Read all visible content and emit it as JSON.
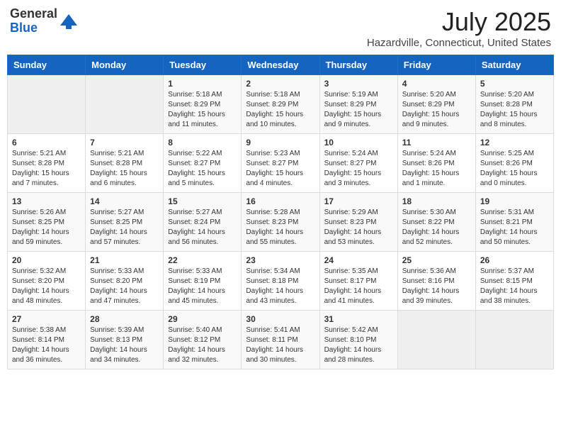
{
  "logo": {
    "general": "General",
    "blue": "Blue"
  },
  "title": {
    "month_year": "July 2025",
    "location": "Hazardville, Connecticut, United States"
  },
  "weekdays": [
    "Sunday",
    "Monday",
    "Tuesday",
    "Wednesday",
    "Thursday",
    "Friday",
    "Saturday"
  ],
  "weeks": [
    [
      {
        "day": "",
        "sunrise": "",
        "sunset": "",
        "daylight": ""
      },
      {
        "day": "",
        "sunrise": "",
        "sunset": "",
        "daylight": ""
      },
      {
        "day": "1",
        "sunrise": "Sunrise: 5:18 AM",
        "sunset": "Sunset: 8:29 PM",
        "daylight": "Daylight: 15 hours and 11 minutes."
      },
      {
        "day": "2",
        "sunrise": "Sunrise: 5:18 AM",
        "sunset": "Sunset: 8:29 PM",
        "daylight": "Daylight: 15 hours and 10 minutes."
      },
      {
        "day": "3",
        "sunrise": "Sunrise: 5:19 AM",
        "sunset": "Sunset: 8:29 PM",
        "daylight": "Daylight: 15 hours and 9 minutes."
      },
      {
        "day": "4",
        "sunrise": "Sunrise: 5:20 AM",
        "sunset": "Sunset: 8:29 PM",
        "daylight": "Daylight: 15 hours and 9 minutes."
      },
      {
        "day": "5",
        "sunrise": "Sunrise: 5:20 AM",
        "sunset": "Sunset: 8:28 PM",
        "daylight": "Daylight: 15 hours and 8 minutes."
      }
    ],
    [
      {
        "day": "6",
        "sunrise": "Sunrise: 5:21 AM",
        "sunset": "Sunset: 8:28 PM",
        "daylight": "Daylight: 15 hours and 7 minutes."
      },
      {
        "day": "7",
        "sunrise": "Sunrise: 5:21 AM",
        "sunset": "Sunset: 8:28 PM",
        "daylight": "Daylight: 15 hours and 6 minutes."
      },
      {
        "day": "8",
        "sunrise": "Sunrise: 5:22 AM",
        "sunset": "Sunset: 8:27 PM",
        "daylight": "Daylight: 15 hours and 5 minutes."
      },
      {
        "day": "9",
        "sunrise": "Sunrise: 5:23 AM",
        "sunset": "Sunset: 8:27 PM",
        "daylight": "Daylight: 15 hours and 4 minutes."
      },
      {
        "day": "10",
        "sunrise": "Sunrise: 5:24 AM",
        "sunset": "Sunset: 8:27 PM",
        "daylight": "Daylight: 15 hours and 3 minutes."
      },
      {
        "day": "11",
        "sunrise": "Sunrise: 5:24 AM",
        "sunset": "Sunset: 8:26 PM",
        "daylight": "Daylight: 15 hours and 1 minute."
      },
      {
        "day": "12",
        "sunrise": "Sunrise: 5:25 AM",
        "sunset": "Sunset: 8:26 PM",
        "daylight": "Daylight: 15 hours and 0 minutes."
      }
    ],
    [
      {
        "day": "13",
        "sunrise": "Sunrise: 5:26 AM",
        "sunset": "Sunset: 8:25 PM",
        "daylight": "Daylight: 14 hours and 59 minutes."
      },
      {
        "day": "14",
        "sunrise": "Sunrise: 5:27 AM",
        "sunset": "Sunset: 8:25 PM",
        "daylight": "Daylight: 14 hours and 57 minutes."
      },
      {
        "day": "15",
        "sunrise": "Sunrise: 5:27 AM",
        "sunset": "Sunset: 8:24 PM",
        "daylight": "Daylight: 14 hours and 56 minutes."
      },
      {
        "day": "16",
        "sunrise": "Sunrise: 5:28 AM",
        "sunset": "Sunset: 8:23 PM",
        "daylight": "Daylight: 14 hours and 55 minutes."
      },
      {
        "day": "17",
        "sunrise": "Sunrise: 5:29 AM",
        "sunset": "Sunset: 8:23 PM",
        "daylight": "Daylight: 14 hours and 53 minutes."
      },
      {
        "day": "18",
        "sunrise": "Sunrise: 5:30 AM",
        "sunset": "Sunset: 8:22 PM",
        "daylight": "Daylight: 14 hours and 52 minutes."
      },
      {
        "day": "19",
        "sunrise": "Sunrise: 5:31 AM",
        "sunset": "Sunset: 8:21 PM",
        "daylight": "Daylight: 14 hours and 50 minutes."
      }
    ],
    [
      {
        "day": "20",
        "sunrise": "Sunrise: 5:32 AM",
        "sunset": "Sunset: 8:20 PM",
        "daylight": "Daylight: 14 hours and 48 minutes."
      },
      {
        "day": "21",
        "sunrise": "Sunrise: 5:33 AM",
        "sunset": "Sunset: 8:20 PM",
        "daylight": "Daylight: 14 hours and 47 minutes."
      },
      {
        "day": "22",
        "sunrise": "Sunrise: 5:33 AM",
        "sunset": "Sunset: 8:19 PM",
        "daylight": "Daylight: 14 hours and 45 minutes."
      },
      {
        "day": "23",
        "sunrise": "Sunrise: 5:34 AM",
        "sunset": "Sunset: 8:18 PM",
        "daylight": "Daylight: 14 hours and 43 minutes."
      },
      {
        "day": "24",
        "sunrise": "Sunrise: 5:35 AM",
        "sunset": "Sunset: 8:17 PM",
        "daylight": "Daylight: 14 hours and 41 minutes."
      },
      {
        "day": "25",
        "sunrise": "Sunrise: 5:36 AM",
        "sunset": "Sunset: 8:16 PM",
        "daylight": "Daylight: 14 hours and 39 minutes."
      },
      {
        "day": "26",
        "sunrise": "Sunrise: 5:37 AM",
        "sunset": "Sunset: 8:15 PM",
        "daylight": "Daylight: 14 hours and 38 minutes."
      }
    ],
    [
      {
        "day": "27",
        "sunrise": "Sunrise: 5:38 AM",
        "sunset": "Sunset: 8:14 PM",
        "daylight": "Daylight: 14 hours and 36 minutes."
      },
      {
        "day": "28",
        "sunrise": "Sunrise: 5:39 AM",
        "sunset": "Sunset: 8:13 PM",
        "daylight": "Daylight: 14 hours and 34 minutes."
      },
      {
        "day": "29",
        "sunrise": "Sunrise: 5:40 AM",
        "sunset": "Sunset: 8:12 PM",
        "daylight": "Daylight: 14 hours and 32 minutes."
      },
      {
        "day": "30",
        "sunrise": "Sunrise: 5:41 AM",
        "sunset": "Sunset: 8:11 PM",
        "daylight": "Daylight: 14 hours and 30 minutes."
      },
      {
        "day": "31",
        "sunrise": "Sunrise: 5:42 AM",
        "sunset": "Sunset: 8:10 PM",
        "daylight": "Daylight: 14 hours and 28 minutes."
      },
      {
        "day": "",
        "sunrise": "",
        "sunset": "",
        "daylight": ""
      },
      {
        "day": "",
        "sunrise": "",
        "sunset": "",
        "daylight": ""
      }
    ]
  ]
}
